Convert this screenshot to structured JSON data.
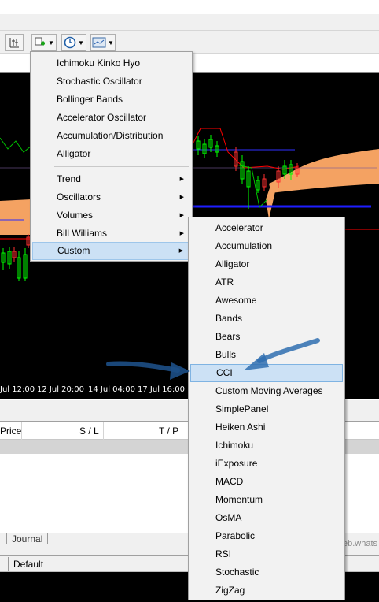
{
  "toolbar": {
    "buttons": [
      {
        "icon": "period-separator-icon"
      },
      {
        "icon": "indicators-add-icon"
      },
      {
        "icon": "clock-periodicity-icon"
      },
      {
        "icon": "templates-icon"
      }
    ]
  },
  "chart": {
    "time_labels": [
      "Jul 12:00",
      "12 Jul 20:00",
      "14 Jul 04:00",
      "17 Jul 16:00"
    ],
    "colors": {
      "background": "#000000",
      "cloud": "#f4a262",
      "bull_candle": "#00ff00",
      "bear_candle": "#ff3030",
      "line_blue": "#0000ff",
      "line_red": "#ff0000"
    }
  },
  "terminal": {
    "columns": [
      "Price",
      "S / L",
      "T / P"
    ],
    "tab_journal": "Journal",
    "ghost_text": "eb.whats",
    "status": "Default"
  },
  "indicators_menu": {
    "items": [
      "Ichimoku Kinko Hyo",
      "Stochastic Oscillator",
      "Bollinger Bands",
      "Accelerator Oscillator",
      "Accumulation/Distribution",
      "Alligator"
    ],
    "groups": [
      {
        "label": "Trend",
        "has_submenu": true
      },
      {
        "label": "Oscillators",
        "has_submenu": true
      },
      {
        "label": "Volumes",
        "has_submenu": true
      },
      {
        "label": "Bill Williams",
        "has_submenu": true
      },
      {
        "label": "Custom",
        "has_submenu": true,
        "highlighted": true
      }
    ]
  },
  "custom_submenu": {
    "items": [
      "Accelerator",
      "Accumulation",
      "Alligator",
      "ATR",
      "Awesome",
      "Bands",
      "Bears",
      "Bulls",
      "CCI",
      "Custom Moving Averages",
      "SimplePanel",
      "Heiken Ashi",
      "Ichimoku",
      "iExposure",
      "MACD",
      "Momentum",
      "OsMA",
      "Parabolic",
      "RSI",
      "Stochastic",
      "ZigZag"
    ],
    "highlighted": "CCI",
    "accent": "#cce1f5"
  }
}
